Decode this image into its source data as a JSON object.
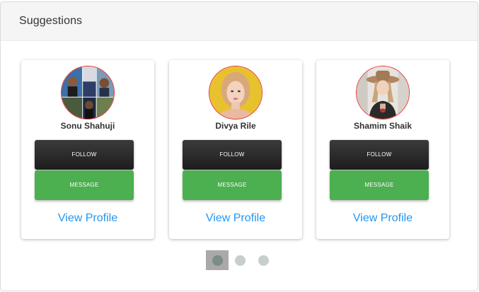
{
  "panel": {
    "title": "Suggestions"
  },
  "suggestions": [
    {
      "name": "Sonu Shahuji",
      "follow_label": "FOLLOW",
      "message_label": "MESSAGE",
      "view_label": "View Profile",
      "avatar": "collage-photo"
    },
    {
      "name": "Divya Rile",
      "follow_label": "FOLLOW",
      "message_label": "MESSAGE",
      "view_label": "View Profile",
      "avatar": "woman-yellow-background-photo"
    },
    {
      "name": "Shamim Shaik",
      "follow_label": "FOLLOW",
      "message_label": "MESSAGE",
      "view_label": "View Profile",
      "avatar": "woman-hat-photo"
    }
  ],
  "carousel": {
    "page_count": 3,
    "active_index": 0
  },
  "colors": {
    "follow": "#1d1d1d",
    "message": "#4caf50",
    "link": "#2196f3",
    "avatar_border": "#e53935",
    "dot_active": "#7c8c86",
    "dot_inactive": "#c7cecb"
  }
}
